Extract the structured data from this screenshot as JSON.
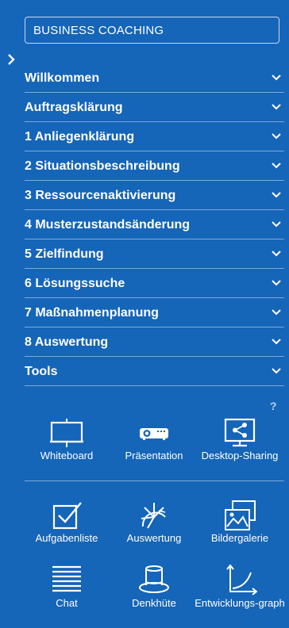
{
  "header": {
    "title": "BUSINESS COACHING"
  },
  "menu": [
    {
      "label": "Willkommen"
    },
    {
      "label": "Auftragsklärung"
    },
    {
      "label": "1 Anliegenklärung"
    },
    {
      "label": "2 Situationsbeschreibung"
    },
    {
      "label": "3 Ressourcenaktivierung"
    },
    {
      "label": "4 Musterzustandsänderung"
    },
    {
      "label": "5 Zielfindung"
    },
    {
      "label": "6 Lösungssuche"
    },
    {
      "label": "7 Maßnahmenplanung"
    },
    {
      "label": "8 Auswertung"
    },
    {
      "label": "Tools"
    }
  ],
  "help": "?",
  "tools_primary": [
    {
      "label": "Whiteboard",
      "icon": "whiteboard-icon"
    },
    {
      "label": "Präsentation",
      "icon": "projector-icon"
    },
    {
      "label": "Desktop-Sharing",
      "icon": "desktop-sharing-icon"
    }
  ],
  "tools_secondary": [
    {
      "label": "Aufgabenliste",
      "icon": "checkbox-icon"
    },
    {
      "label": "Auswertung",
      "icon": "evaluation-icon"
    },
    {
      "label": "Bildergalerie",
      "icon": "gallery-icon"
    },
    {
      "label": "Chat",
      "icon": "chat-lines-icon"
    },
    {
      "label": "Denkhüte",
      "icon": "hat-icon"
    },
    {
      "label": "Entwicklungs-graph",
      "icon": "graph-icon"
    }
  ],
  "colors": {
    "background": "#1565b8",
    "foreground": "#ffffff"
  }
}
